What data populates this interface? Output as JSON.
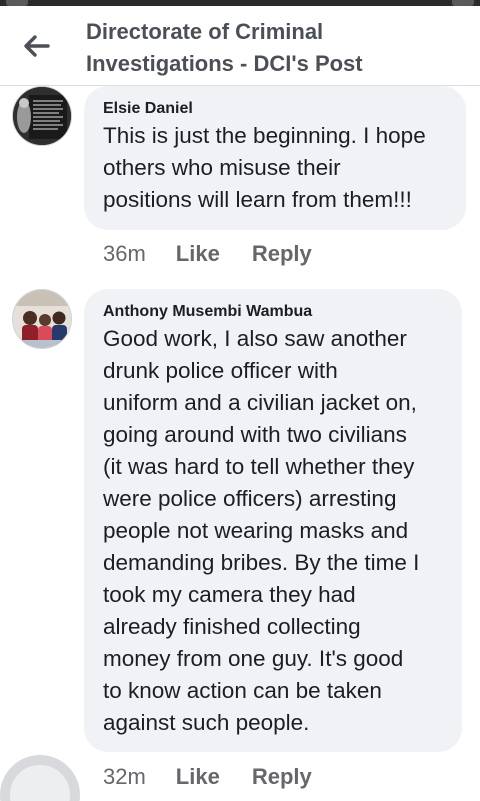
{
  "header": {
    "title_line1": "Directorate of Criminal",
    "title_line2": "Investigations - DCI's Post"
  },
  "comments": [
    {
      "author": "Elsie Daniel",
      "text_lines": [
        "This is just the beginning. I hope",
        "others who misuse their",
        "positions will learn from them!!!"
      ],
      "time": "36m",
      "like_label": "Like",
      "reply_label": "Reply"
    },
    {
      "author": "Anthony Musembi Wambua",
      "text_lines": [
        "Good work, I also saw another",
        "drunk police officer with",
        "uniform and a civilian jacket on,",
        "going around with two civilians",
        "(it was hard to tell whether they",
        "were police officers) arresting",
        "people not wearing masks and",
        "demanding bribes. By the time I",
        "took my camera they had",
        "already finished collecting",
        "money from one guy. It's good",
        "to know action can be taken",
        "against such people."
      ],
      "time": "32m",
      "like_label": "Like",
      "reply_label": "Reply"
    }
  ],
  "icons": {
    "back": "back-arrow-icon"
  },
  "colors": {
    "bubble": "#f0f2f5",
    "header_text": "#4b4f56",
    "meta_text": "#65676b"
  }
}
